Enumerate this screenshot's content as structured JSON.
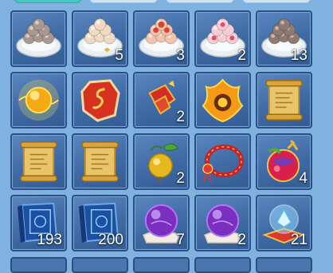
{
  "inventory": {
    "items": [
      {
        "icon": "rice-balls-plate-gray-icon",
        "count": ""
      },
      {
        "icon": "rice-balls-plate-cream-icon",
        "count": "5"
      },
      {
        "icon": "rice-balls-plate-red-icon",
        "count": "3"
      },
      {
        "icon": "rice-balls-plate-pink-icon",
        "count": "2"
      },
      {
        "icon": "rice-balls-plate-dark-icon",
        "count": "13"
      },
      {
        "icon": "golden-orb-icon",
        "count": ""
      },
      {
        "icon": "red-rune-stone-icon",
        "count": ""
      },
      {
        "icon": "red-talisman-icon",
        "count": "2"
      },
      {
        "icon": "flame-crest-icon",
        "count": ""
      },
      {
        "icon": "golden-scroll-icon",
        "count": ""
      },
      {
        "icon": "golden-scroll-icon",
        "count": ""
      },
      {
        "icon": "golden-scroll-icon",
        "count": ""
      },
      {
        "icon": "golden-fruit-icon",
        "count": "2"
      },
      {
        "icon": "red-bracelet-icon",
        "count": ""
      },
      {
        "icon": "magic-fruit-icon",
        "count": "4"
      },
      {
        "icon": "blue-book-icon",
        "count": "193"
      },
      {
        "icon": "blue-book-icon",
        "count": "200"
      },
      {
        "icon": "purple-orb-icon",
        "count": "7"
      },
      {
        "icon": "purple-orb-icon",
        "count": "2"
      },
      {
        "icon": "crystal-shrine-icon",
        "count": "21"
      }
    ]
  }
}
